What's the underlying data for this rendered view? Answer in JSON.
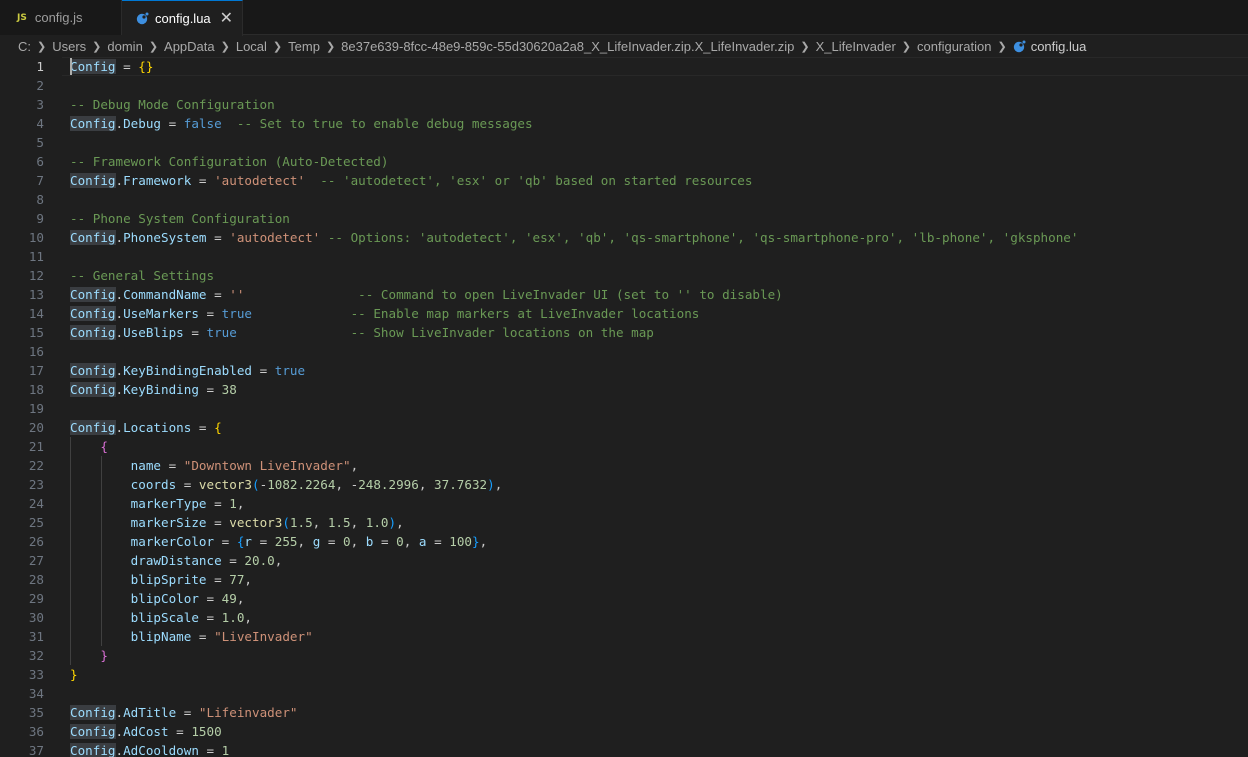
{
  "tabs": [
    {
      "icon": "JS",
      "label": "config.js"
    },
    {
      "label": "config.lua",
      "close": "✕"
    }
  ],
  "breadcrumb": [
    "C:",
    "Users",
    "domin",
    "AppData",
    "Local",
    "Temp",
    "8e37e639-8fcc-48e9-859c-55d30620a2a8_X_LifeInvader.zip.X_LifeInvader.zip",
    "X_LifeInvader",
    "configuration",
    "config.lua"
  ],
  "lines": [
    {
      "n": "1",
      "t": [
        [
          "cfg",
          "Config"
        ],
        [
          "",
          "␠= "
        ],
        [
          "br1",
          "{}"
        ]
      ]
    },
    {
      "n": "2",
      "t": []
    },
    {
      "n": "3",
      "t": [
        [
          "cm",
          "-- Debug Mode Configuration"
        ]
      ]
    },
    {
      "n": "4",
      "t": [
        [
          "cfg",
          "Config"
        ],
        [
          "",
          ".",
          ""
        ],
        [
          "fld",
          "Debug"
        ],
        [
          "",
          "␠= "
        ],
        [
          "kw",
          "false"
        ],
        [
          "",
          "␠␠"
        ],
        [
          "cm",
          "-- Set to true to enable debug messages"
        ]
      ]
    },
    {
      "n": "5",
      "t": []
    },
    {
      "n": "6",
      "t": [
        [
          "cm",
          "-- Framework Configuration (Auto-Detected)"
        ]
      ]
    },
    {
      "n": "7",
      "t": [
        [
          "cfg",
          "Config"
        ],
        [
          "",
          "."
        ],
        [
          "fld",
          "Framework"
        ],
        [
          "",
          "␠= "
        ],
        [
          "str",
          "'autodetect'"
        ],
        [
          "",
          "␠␠"
        ],
        [
          "cm",
          "-- 'autodetect', 'esx' or 'qb' based on started resources"
        ]
      ]
    },
    {
      "n": "8",
      "t": []
    },
    {
      "n": "9",
      "t": [
        [
          "cm",
          "-- Phone System Configuration"
        ]
      ]
    },
    {
      "n": "10",
      "t": [
        [
          "cfg",
          "Config"
        ],
        [
          "",
          "."
        ],
        [
          "fld",
          "PhoneSystem"
        ],
        [
          "",
          "␠= "
        ],
        [
          "str",
          "'autodetect'"
        ],
        [
          "",
          "␠"
        ],
        [
          "cm",
          "-- Options: 'autodetect', 'esx', 'qb', 'qs-smartphone', 'qs-smartphone-pro', 'lb-phone', 'gksphone'"
        ]
      ]
    },
    {
      "n": "11",
      "t": []
    },
    {
      "n": "12",
      "t": [
        [
          "cm",
          "-- General Settings"
        ]
      ]
    },
    {
      "n": "13",
      "t": [
        [
          "cfg",
          "Config"
        ],
        [
          "",
          "."
        ],
        [
          "fld",
          "CommandName"
        ],
        [
          "",
          "␠= "
        ],
        [
          "str",
          "''"
        ],
        [
          "",
          "␠␠␠␠␠␠␠␠␠␠␠␠␠␠␠"
        ],
        [
          "cm",
          "-- Command to open LiveInvader UI (set to '' to disable)"
        ]
      ]
    },
    {
      "n": "14",
      "t": [
        [
          "cfg",
          "Config"
        ],
        [
          "",
          "."
        ],
        [
          "fld",
          "UseMarkers"
        ],
        [
          "",
          "␠= "
        ],
        [
          "kw",
          "true"
        ],
        [
          "",
          "␠␠␠␠␠␠␠␠␠␠␠␠␠"
        ],
        [
          "cm",
          "-- Enable map markers at LiveInvader locations"
        ]
      ]
    },
    {
      "n": "15",
      "t": [
        [
          "cfg",
          "Config"
        ],
        [
          "",
          "."
        ],
        [
          "fld",
          "UseBlips"
        ],
        [
          "",
          "␠= "
        ],
        [
          "kw",
          "true"
        ],
        [
          "",
          "␠␠␠␠␠␠␠␠␠␠␠␠␠␠␠"
        ],
        [
          "cm",
          "-- Show LiveInvader locations on the map"
        ]
      ]
    },
    {
      "n": "16",
      "t": []
    },
    {
      "n": "17",
      "t": [
        [
          "cfg",
          "Config"
        ],
        [
          "",
          "."
        ],
        [
          "fld",
          "KeyBindingEnabled"
        ],
        [
          "",
          "␠= "
        ],
        [
          "kw",
          "true"
        ]
      ]
    },
    {
      "n": "18",
      "t": [
        [
          "cfg",
          "Config"
        ],
        [
          "",
          "."
        ],
        [
          "fld",
          "KeyBinding"
        ],
        [
          "",
          "␠= "
        ],
        [
          "num",
          "38"
        ]
      ]
    },
    {
      "n": "19",
      "t": []
    },
    {
      "n": "20",
      "t": [
        [
          "cfg",
          "Config"
        ],
        [
          "",
          "."
        ],
        [
          "fld",
          "Locations"
        ],
        [
          "",
          "␠= "
        ],
        [
          "br1",
          "{"
        ]
      ]
    },
    {
      "n": "21",
      "t": [
        [
          "",
          "␠␠␠␠"
        ],
        [
          "br2",
          "{"
        ]
      ]
    },
    {
      "n": "22",
      "t": [
        [
          "",
          "␠␠␠␠␠␠␠␠"
        ],
        [
          "fld",
          "name"
        ],
        [
          "",
          "␠= "
        ],
        [
          "str",
          "\"Downtown LiveInvader\""
        ],
        [
          "",
          ","
        ]
      ]
    },
    {
      "n": "23",
      "t": [
        [
          "",
          "␠␠␠␠␠␠␠␠"
        ],
        [
          "fld",
          "coords"
        ],
        [
          "",
          "␠= "
        ],
        [
          "fn",
          "vector3"
        ],
        [
          "br3",
          "("
        ],
        [
          "",
          "-"
        ],
        [
          "num",
          "1082.2264"
        ],
        [
          "",
          ", -"
        ],
        [
          "num",
          "248.2996"
        ],
        [
          "",
          ", "
        ],
        [
          "num",
          "37.7632"
        ],
        [
          "br3",
          ")"
        ],
        [
          "",
          ","
        ]
      ]
    },
    {
      "n": "24",
      "t": [
        [
          "",
          "␠␠␠␠␠␠␠␠"
        ],
        [
          "fld",
          "markerType"
        ],
        [
          "",
          "␠= "
        ],
        [
          "num",
          "1"
        ],
        [
          "",
          ","
        ]
      ]
    },
    {
      "n": "25",
      "t": [
        [
          "",
          "␠␠␠␠␠␠␠␠"
        ],
        [
          "fld",
          "markerSize"
        ],
        [
          "",
          "␠= "
        ],
        [
          "fn",
          "vector3"
        ],
        [
          "br3",
          "("
        ],
        [
          "num",
          "1.5"
        ],
        [
          "",
          ", "
        ],
        [
          "num",
          "1.5"
        ],
        [
          "",
          ", "
        ],
        [
          "num",
          "1.0"
        ],
        [
          "br3",
          ")"
        ],
        [
          "",
          ","
        ]
      ]
    },
    {
      "n": "26",
      "t": [
        [
          "",
          "␠␠␠␠␠␠␠␠"
        ],
        [
          "fld",
          "markerColor"
        ],
        [
          "",
          "␠= "
        ],
        [
          "br3",
          "{"
        ],
        [
          "fld",
          "r"
        ],
        [
          "",
          "␠= "
        ],
        [
          "num",
          "255"
        ],
        [
          "",
          ", "
        ],
        [
          "fld",
          "g"
        ],
        [
          "",
          "␠= "
        ],
        [
          "num",
          "0"
        ],
        [
          "",
          ", "
        ],
        [
          "fld",
          "b"
        ],
        [
          "",
          "␠= "
        ],
        [
          "num",
          "0"
        ],
        [
          "",
          ", "
        ],
        [
          "fld",
          "a"
        ],
        [
          "",
          "␠= "
        ],
        [
          "num",
          "100"
        ],
        [
          "br3",
          "}"
        ],
        [
          "",
          ","
        ]
      ]
    },
    {
      "n": "27",
      "t": [
        [
          "",
          "␠␠␠␠␠␠␠␠"
        ],
        [
          "fld",
          "drawDistance"
        ],
        [
          "",
          "␠= "
        ],
        [
          "num",
          "20.0"
        ],
        [
          "",
          ","
        ]
      ]
    },
    {
      "n": "28",
      "t": [
        [
          "",
          "␠␠␠␠␠␠␠␠"
        ],
        [
          "fld",
          "blipSprite"
        ],
        [
          "",
          "␠= "
        ],
        [
          "num",
          "77"
        ],
        [
          "",
          ","
        ]
      ]
    },
    {
      "n": "29",
      "t": [
        [
          "",
          "␠␠␠␠␠␠␠␠"
        ],
        [
          "fld",
          "blipColor"
        ],
        [
          "",
          "␠= "
        ],
        [
          "num",
          "49"
        ],
        [
          "",
          ","
        ]
      ]
    },
    {
      "n": "30",
      "t": [
        [
          "",
          "␠␠␠␠␠␠␠␠"
        ],
        [
          "fld",
          "blipScale"
        ],
        [
          "",
          "␠= "
        ],
        [
          "num",
          "1.0"
        ],
        [
          "",
          ","
        ]
      ]
    },
    {
      "n": "31",
      "t": [
        [
          "",
          "␠␠␠␠␠␠␠␠"
        ],
        [
          "fld",
          "blipName"
        ],
        [
          "",
          "␠= "
        ],
        [
          "str",
          "\"LiveInvader\""
        ]
      ]
    },
    {
      "n": "32",
      "t": [
        [
          "",
          "␠␠␠␠"
        ],
        [
          "br2",
          "}"
        ]
      ]
    },
    {
      "n": "33",
      "t": [
        [
          "br1",
          "}"
        ]
      ]
    },
    {
      "n": "34",
      "t": []
    },
    {
      "n": "35",
      "t": [
        [
          "cfg",
          "Config"
        ],
        [
          "",
          "."
        ],
        [
          "fld",
          "AdTitle"
        ],
        [
          "",
          "␠= "
        ],
        [
          "str",
          "\"Lifeinvader\""
        ]
      ]
    },
    {
      "n": "36",
      "t": [
        [
          "cfg",
          "Config"
        ],
        [
          "",
          "."
        ],
        [
          "fld",
          "AdCost"
        ],
        [
          "",
          "␠= "
        ],
        [
          "num",
          "1500"
        ]
      ]
    },
    {
      "n": "37",
      "t": [
        [
          "cfg",
          "Config"
        ],
        [
          "",
          "."
        ],
        [
          "fld",
          "AdCooldown"
        ],
        [
          "",
          "␠= "
        ],
        [
          "num",
          "1"
        ]
      ]
    }
  ],
  "active_line": "1"
}
